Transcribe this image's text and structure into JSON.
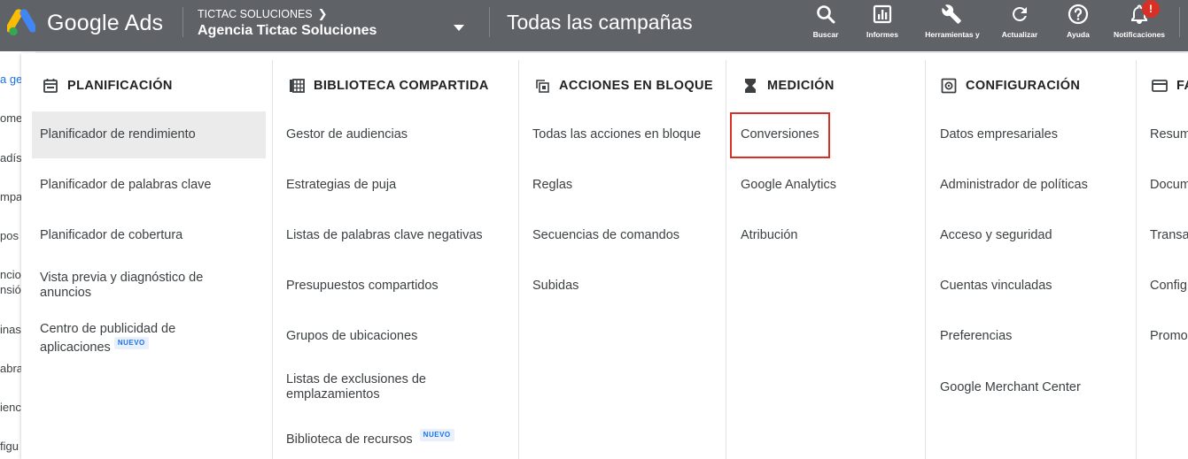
{
  "brand": {
    "name": "Google Ads",
    "colors": {
      "blue": "#4285f4",
      "yellow": "#fbbc04",
      "green": "#34a853"
    }
  },
  "account": {
    "parent": "TICTAC SOLUCIONES",
    "name": "Agencia Tictac Soluciones"
  },
  "page_title": "Todas las campañas",
  "toolbar": [
    {
      "label": "Buscar",
      "icon": "search-icon"
    },
    {
      "label": "Informes",
      "icon": "reports-icon"
    },
    {
      "label": "Herramientas y",
      "icon": "wrench-icon"
    },
    {
      "label": "Actualizar",
      "icon": "refresh-icon"
    },
    {
      "label": "Ayuda",
      "icon": "help-icon"
    },
    {
      "label": "Notificaciones",
      "icon": "bell-icon",
      "badge": "!"
    }
  ],
  "left_nav": [
    "a ge",
    "ome",
    "adíst",
    "mpa",
    "pos",
    "ncio",
    "nsió",
    "inas",
    "abra",
    "ienc",
    "figu"
  ],
  "menu": {
    "columns": [
      {
        "header": "PLANIFICACIÓN",
        "icon": "calendar-icon",
        "items": [
          "Planificador de rendimiento",
          "Planificador de palabras clave",
          "Planificador de cobertura",
          "Vista previa y diagnóstico de anuncios",
          "Centro de publicidad de aplicaciones"
        ],
        "selected": "Planificador de rendimiento"
      },
      {
        "header": "BIBLIOTECA COMPARTIDA",
        "icon": "grid-icon",
        "items": [
          "Gestor de audiencias",
          "Estrategias de puja",
          "Listas de palabras clave negativas",
          "Presupuestos compartidos",
          "Grupos de ubicaciones",
          "Listas de exclusiones de emplazamientos",
          "Biblioteca de recursos"
        ]
      },
      {
        "header": "ACCIONES EN BLOQUE",
        "icon": "copy-icon",
        "items": [
          "Todas las acciones en bloque",
          "Reglas",
          "Secuencias de comandos",
          "Subidas"
        ]
      },
      {
        "header": "MEDICIÓN",
        "icon": "hourglass-icon",
        "items": [
          "Conversiones",
          "Google Analytics",
          "Atribución"
        ],
        "highlighted": "Conversiones"
      },
      {
        "header": "CONFIGURACIÓN",
        "icon": "gear-icon",
        "items": [
          "Datos empresariales",
          "Administrador de políticas",
          "Acceso y seguridad",
          "Cuentas vinculadas",
          "Preferencias",
          "Google Merchant Center"
        ]
      },
      {
        "header": "FA",
        "icon": "credit-card-icon",
        "items": [
          "Resum",
          "Docum",
          "Transa",
          "Config",
          "Promo"
        ]
      }
    ],
    "new_badge": "NUEVO"
  }
}
